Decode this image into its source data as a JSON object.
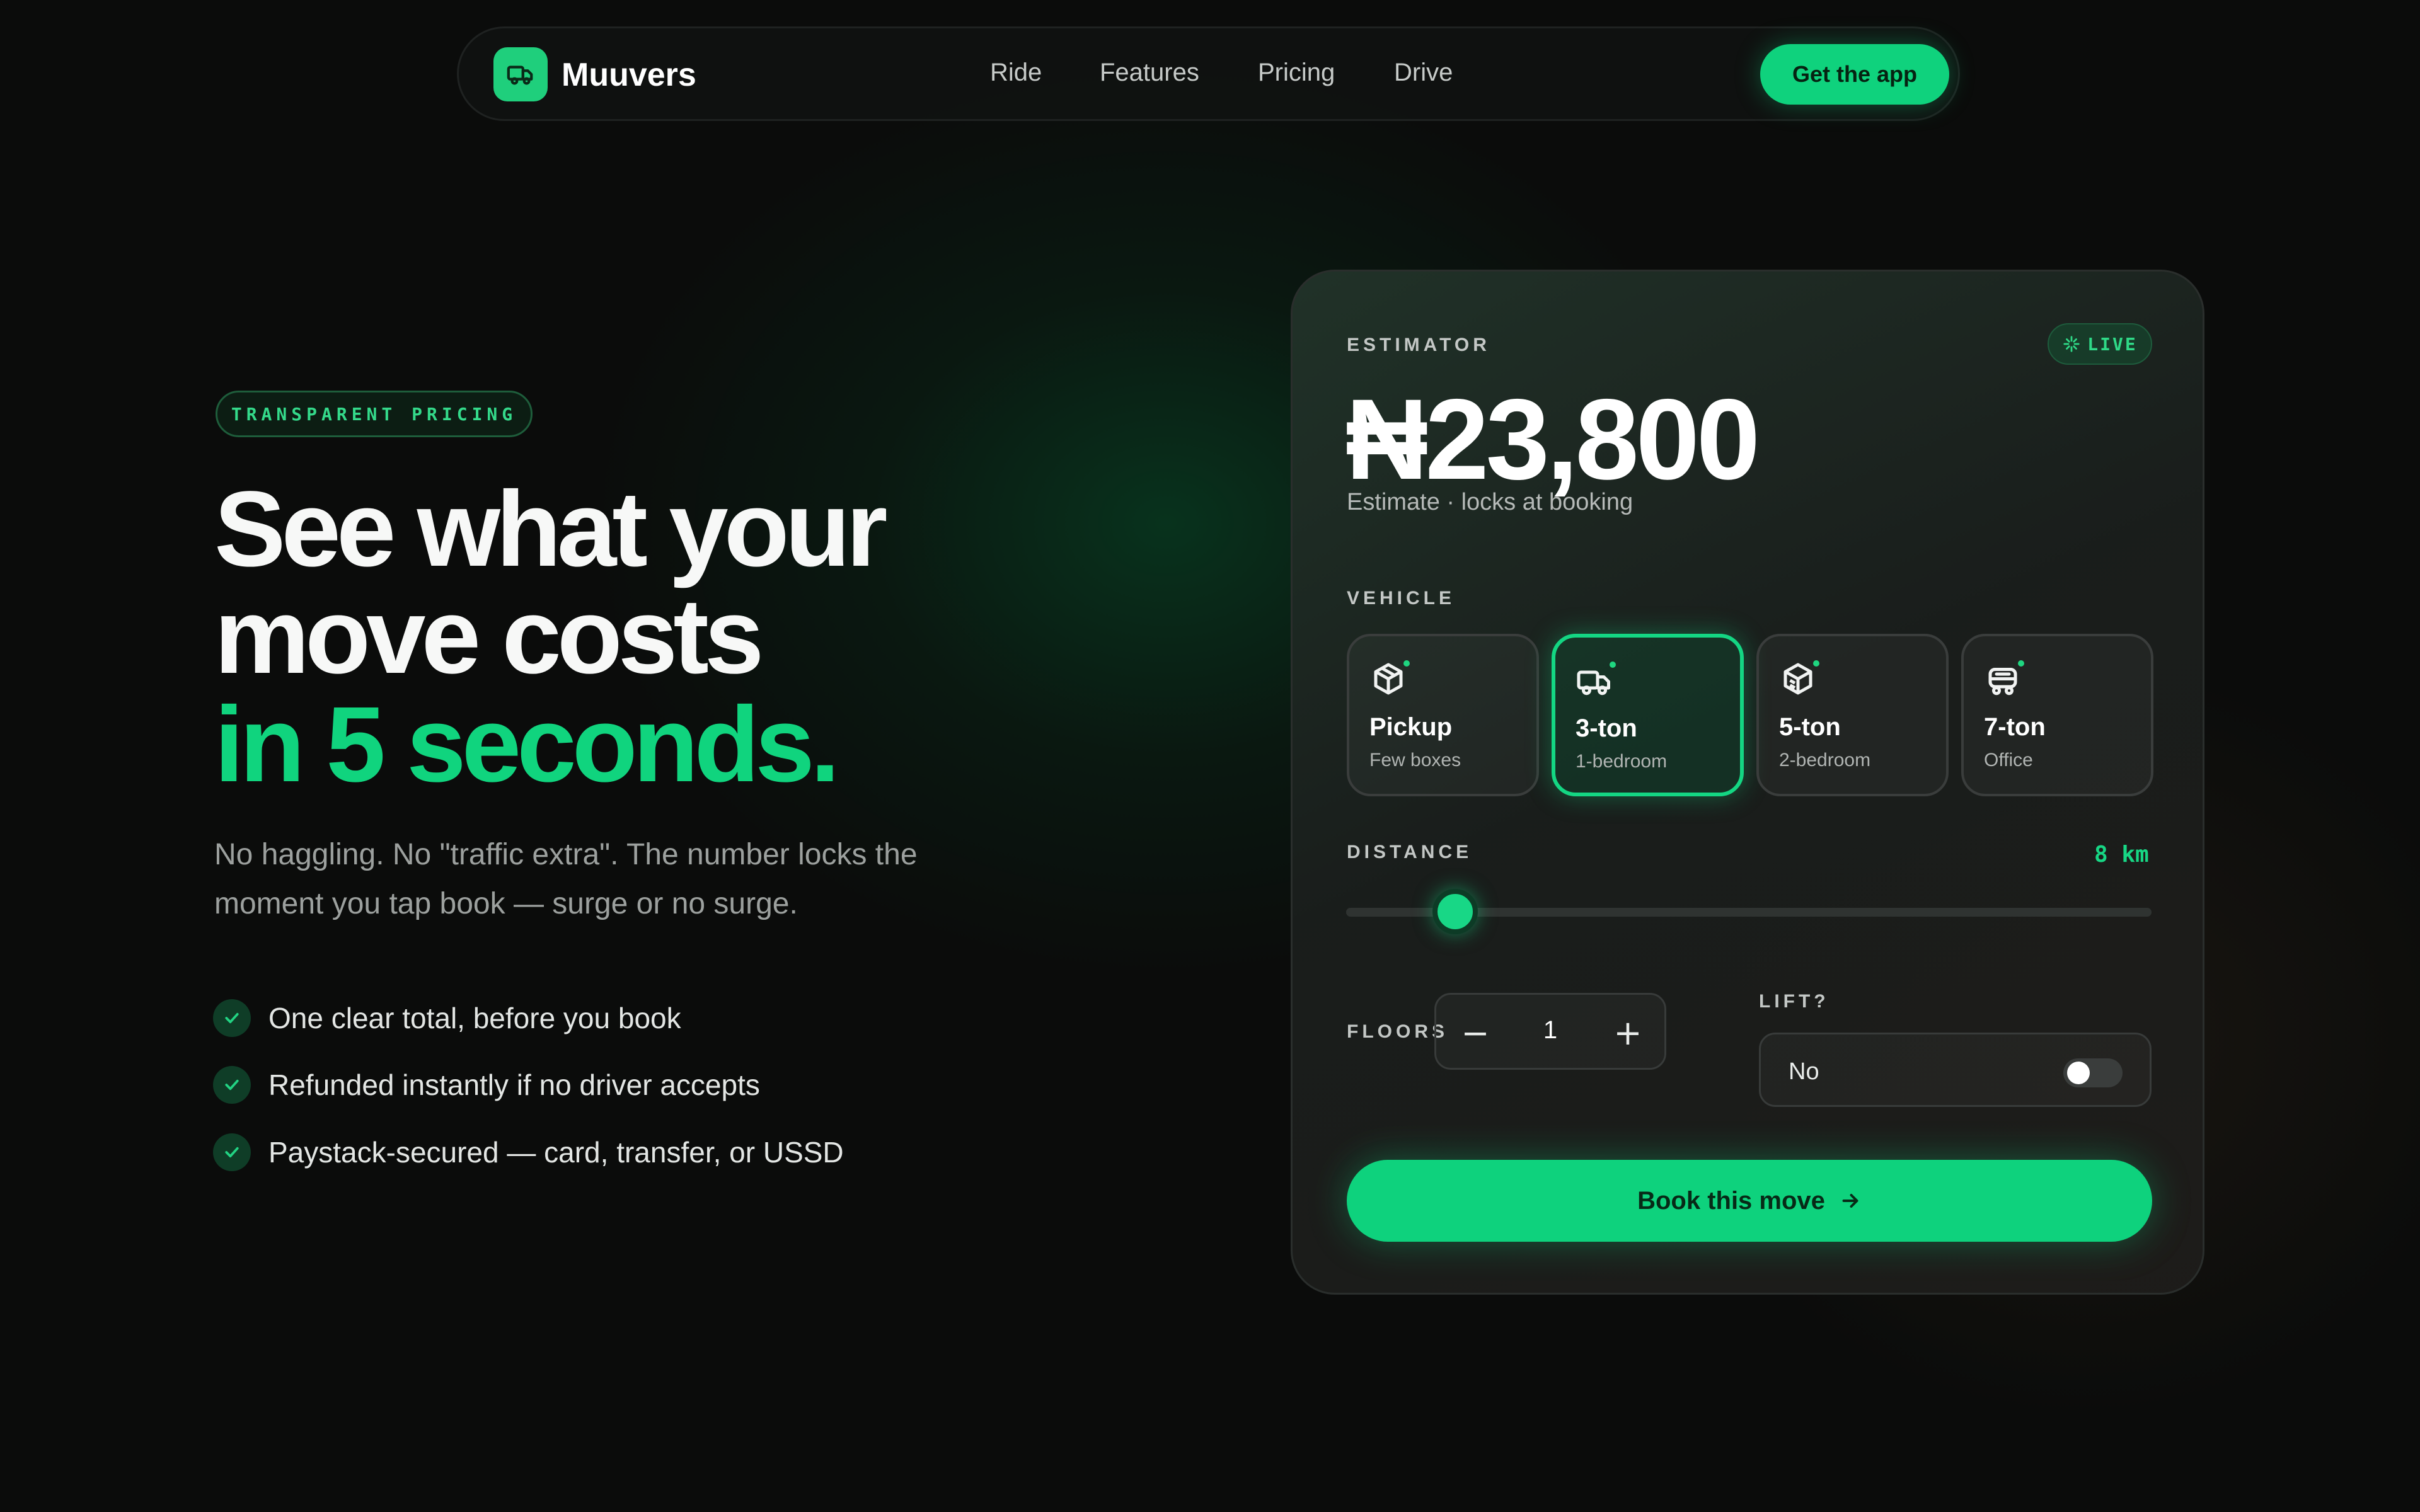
{
  "brand": {
    "name": "Muuvers",
    "accent": "#0fd27d"
  },
  "nav": {
    "links": [
      "Ride",
      "Features",
      "Pricing",
      "Drive"
    ],
    "cta": "Get the app"
  },
  "hero": {
    "eyebrow": "TRANSPARENT PRICING",
    "headline_line1": "See what your",
    "headline_line2": "move costs",
    "headline_line3": "in 5 seconds.",
    "lede": "No haggling. No \"traffic extra\". The number locks the moment you tap book — surge or no surge.",
    "features": [
      "One clear total, before you book",
      "Refunded instantly if no driver accepts",
      "Paystack-secured — card, transfer, or USSD"
    ]
  },
  "estimator": {
    "label": "ESTIMATOR",
    "live_badge": "LIVE",
    "price": "₦23,800",
    "price_note": "Estimate · locks at booking",
    "vehicle_label": "VEHICLE",
    "vehicles": [
      {
        "name": "Pickup",
        "sub": "Few boxes",
        "icon": "box-icon"
      },
      {
        "name": "3-ton",
        "sub": "1-bedroom",
        "icon": "truck-icon"
      },
      {
        "name": "5-ton",
        "sub": "2-bedroom",
        "icon": "package-icon"
      },
      {
        "name": "7-ton",
        "sub": "Office",
        "icon": "office-truck-icon"
      }
    ],
    "selected_vehicle": "3-ton",
    "distance_label": "DISTANCE",
    "distance_value": "8 km",
    "distance_slider_fraction": 0.135,
    "floors_label": "FLOORS",
    "floors_value": "1",
    "floors_minus": "−",
    "floors_plus": "+",
    "lift_label": "LIFT?",
    "lift_value": "No",
    "lift_on": false,
    "book_label": "Book this move"
  }
}
